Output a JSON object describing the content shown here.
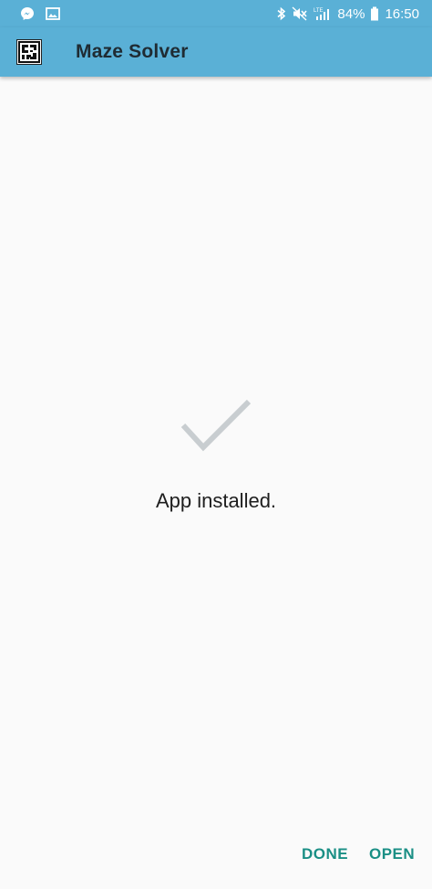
{
  "status_bar": {
    "left_icons": [
      "messenger-icon",
      "image-icon"
    ],
    "right_icons": [
      "bluetooth-icon",
      "mute-icon",
      "lte-signal-icon",
      "battery-icon"
    ],
    "battery_percent": "84%",
    "time": "16:50"
  },
  "app_bar": {
    "title": "Maze Solver",
    "icon": "maze-icon"
  },
  "main": {
    "status_icon": "checkmark-icon",
    "message": "App installed."
  },
  "actions": {
    "done_label": "DONE",
    "open_label": "OPEN"
  },
  "colors": {
    "primary": "#5ab0d6",
    "accent": "#1a8f85",
    "background": "#fafafa",
    "check": "#c8cdd0"
  }
}
